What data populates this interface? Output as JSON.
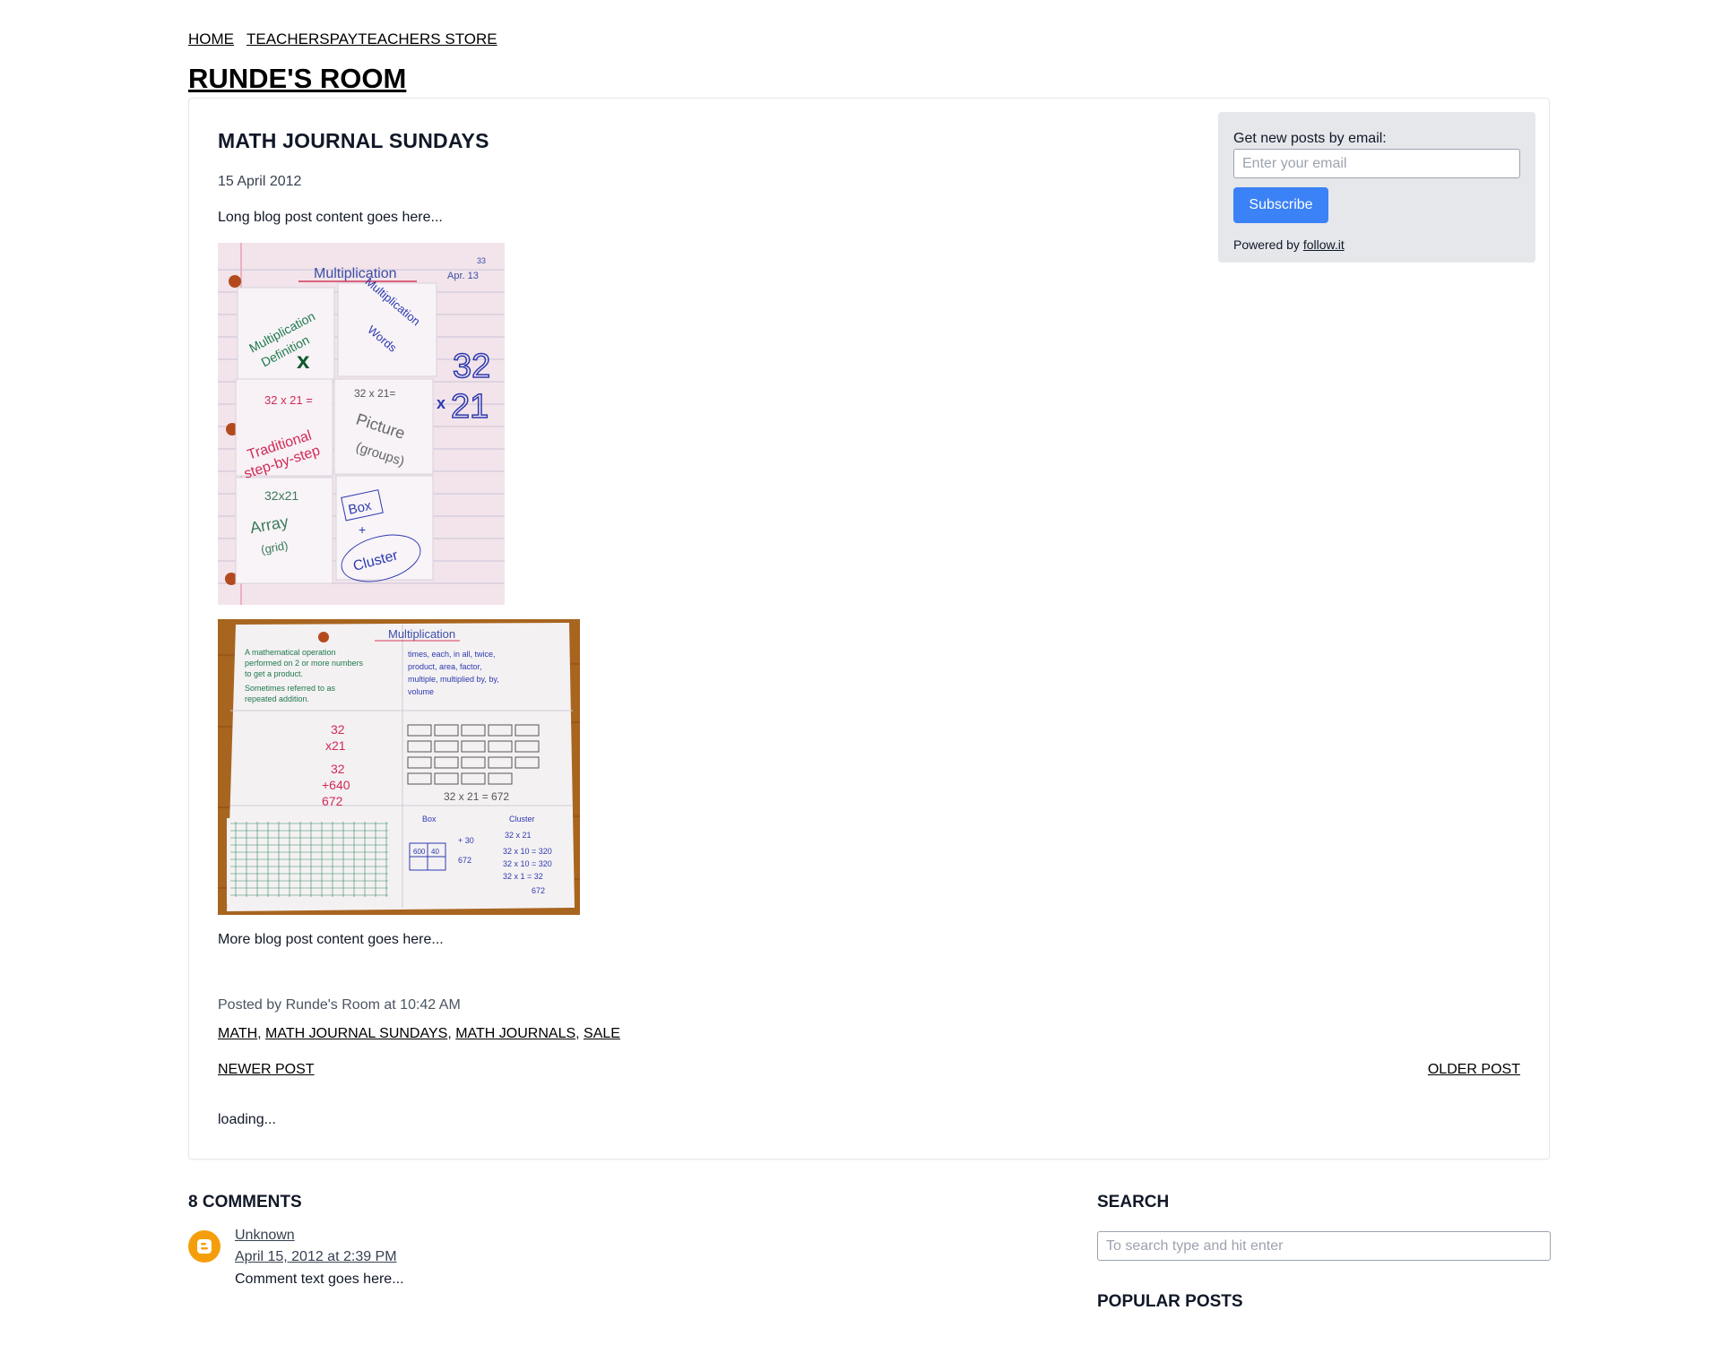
{
  "nav": {
    "home": "HOME",
    "store": "TEACHERSPAYTEACHERS STORE"
  },
  "site": {
    "title": "RUNDE'S ROOM"
  },
  "post": {
    "title": "MATH JOURNAL SUNDAYS",
    "date": "15 April 2012",
    "intro": "Long blog post content goes here...",
    "outro": "More blog post content goes here...",
    "meta": "Posted by Runde's Room at 10:42 AM",
    "labels": [
      "MATH",
      "MATH JOURNAL SUNDAYS",
      "MATH JOURNALS",
      "SALE"
    ],
    "newer": "NEWER POST",
    "older": "OLDER POST",
    "loading": "loading...",
    "images": {
      "first": {
        "page_title": "Multiplication",
        "page_date": "Apr. 13",
        "page_number": "33",
        "flaps": [
          "Multiplication Definition",
          "Multiplication Words",
          "32 x 21 =",
          "Traditional step-by-step",
          "32 x 21 =",
          "Picture (groups)",
          "32 x 21",
          "Array (grid)",
          "Box + Cluster"
        ],
        "side_problem": [
          "32",
          "21"
        ]
      },
      "second": {
        "page_title": "Multiplication"
      }
    }
  },
  "subscribe": {
    "label": "Get new posts by email:",
    "placeholder": "Enter your email",
    "button": "Subscribe",
    "powered_prefix": "Powered by",
    "powered_link": "follow.it",
    "button_color": "#3b82f6"
  },
  "comments": {
    "title": "8 COMMENTS",
    "items": [
      {
        "author": "Unknown",
        "date": "April 15, 2012 at 2:39 PM",
        "text": "Comment text goes here...",
        "avatar_icon": "blogger-icon"
      }
    ]
  },
  "sidebar": {
    "search_title": "SEARCH",
    "search_placeholder": "To search type and hit enter",
    "popular_title": "POPULAR POSTS"
  }
}
